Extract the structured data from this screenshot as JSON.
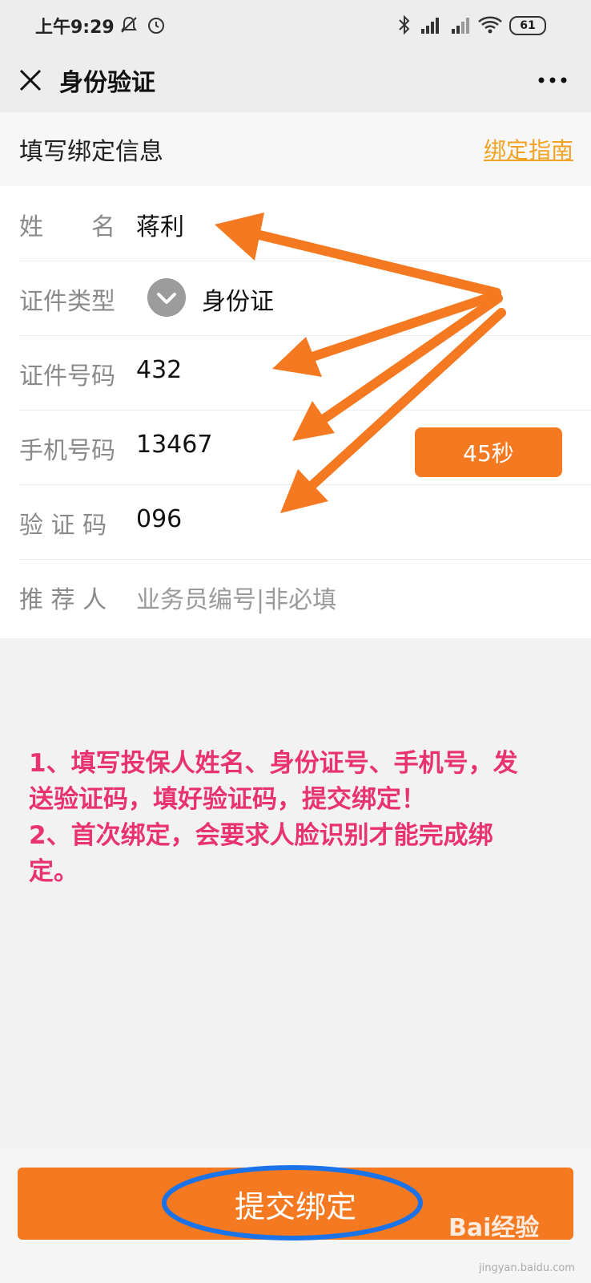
{
  "status_bar": {
    "time": "上午9:29",
    "battery": "61",
    "icons": [
      "mute-icon",
      "alarm-icon",
      "bluetooth-icon",
      "hd-signal-icon",
      "signal-icon",
      "wifi-icon",
      "battery-icon"
    ]
  },
  "nav": {
    "title": "身份验证",
    "close_icon": "close-icon",
    "more_icon": "more-icon"
  },
  "section": {
    "title": "填写绑定信息",
    "guide_link": "绑定指南"
  },
  "form": {
    "name": {
      "label": "姓　　名",
      "value": "蒋利"
    },
    "id_type": {
      "label": "证件类型",
      "value": "身份证"
    },
    "id_number": {
      "label": "证件号码",
      "value": "432"
    },
    "phone": {
      "label": "手机号码",
      "value": "13467"
    },
    "code": {
      "label": "验 证 码",
      "value": "096"
    },
    "referrer": {
      "label": "推 荐 人",
      "placeholder": "业务员编号|非必填"
    },
    "code_button": "45秒"
  },
  "note": {
    "line1": "1、填写投保人姓名、身份证号、手机号，发送验证码，填好验证码，提交绑定！",
    "line2": "2、首次绑定，会要求人脸识别才能完成绑定。"
  },
  "submit_button": "提交绑定",
  "watermark": {
    "logo": "Bai经验",
    "url": "jingyan.baidu.com"
  },
  "colors": {
    "accent": "#f47920",
    "link": "#f4a223",
    "note": "#e8336f",
    "ellipse": "#1a73e8"
  }
}
